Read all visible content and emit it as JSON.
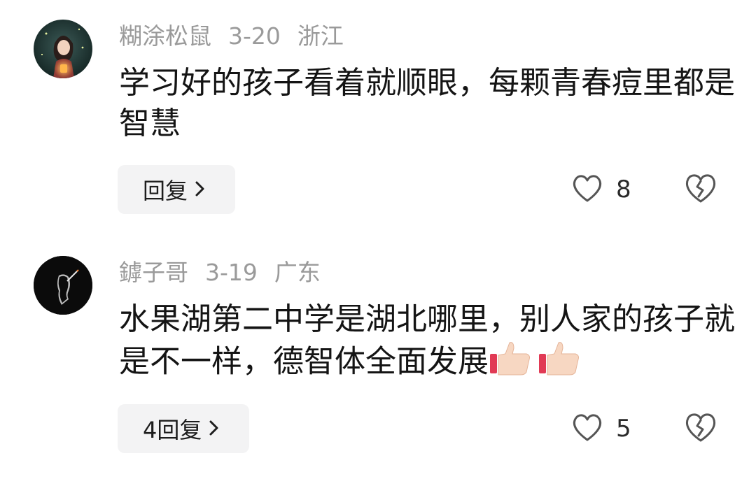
{
  "comments": [
    {
      "username": "糊涂松鼠",
      "date": "3-20",
      "location": "浙江",
      "text": "学习好的孩子看着就顺眼，每颗青春痘里都是智慧",
      "reply_label": "回复",
      "like_count": "8",
      "avatar_icon": "girl-with-lantern-avatar"
    },
    {
      "username": "鏬子哥",
      "date": "3-19",
      "location": "广东",
      "text": "水果湖第二中学是湖北哪里，别人家的孩子就是不一样，德智体全面发展",
      "emoji": "thumbs-up-icon ×2",
      "reply_label": "4回复",
      "like_count": "5",
      "avatar_icon": "silhouette-smoking-avatar"
    }
  ],
  "colors": {
    "meta_text": "#9a9a9a",
    "reply_bg": "#f3f3f4",
    "icon_stroke": "#555555"
  }
}
